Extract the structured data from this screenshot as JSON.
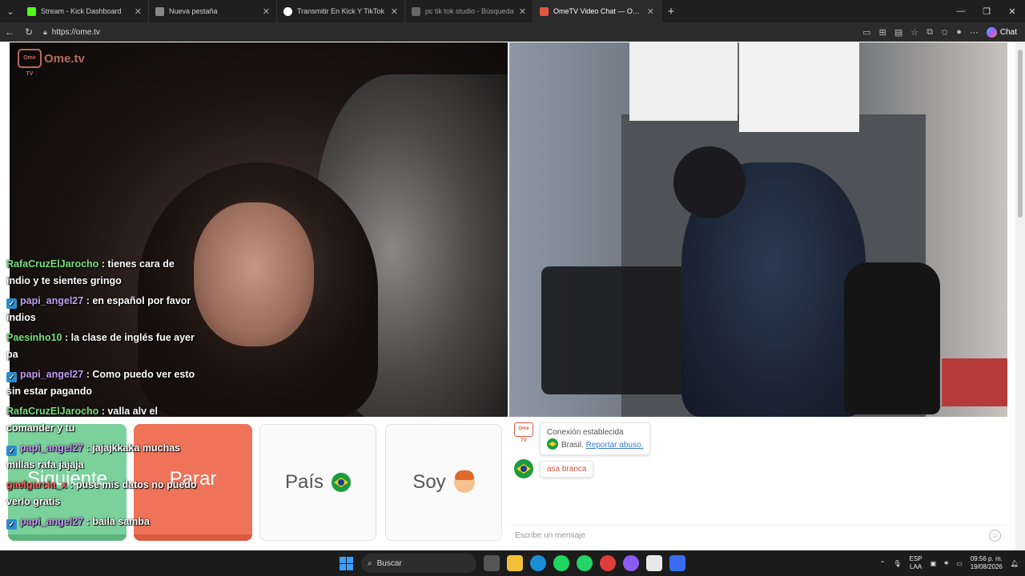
{
  "browser": {
    "tabs": [
      {
        "title": "Stream - Kick Dashboard",
        "color": "#53fc18",
        "active": false
      },
      {
        "title": "Nueva pestaña",
        "color": "#888888",
        "active": false
      },
      {
        "title": "Transmitir En Kick Y TikTok",
        "color": "#ffffff",
        "active": false
      },
      {
        "title": "pc tik tok studio - Búsqueda",
        "color": "#666666",
        "active": false
      },
      {
        "title": "OmeTV Video Chat — Omegl",
        "color": "#e0563f",
        "active": true
      }
    ],
    "url": "https://ome.tv",
    "copilot_label": "Chat"
  },
  "ometv": {
    "logo_text": "Ome.tv",
    "logo_badge": "Ome TV"
  },
  "stream_chat": [
    {
      "user": "RafaCruzElJarocho",
      "user_color": "#7be07b",
      "badge": false,
      "text": ": tienes cara de indio y te sientes gringo"
    },
    {
      "user": "papi_angel27",
      "user_color": "#c39cf2",
      "badge": true,
      "text": ": en español por favor indios"
    },
    {
      "user": "Paesinho10",
      "user_color": "#7be07b",
      "badge": false,
      "text": ": la clase de inglés fue ayer pa"
    },
    {
      "user": "papi_angel27",
      "user_color": "#c39cf2",
      "badge": true,
      "text": ": Como puedo ver esto sin estar pagando"
    },
    {
      "user": "RafaCruzElJarocho",
      "user_color": "#7be07b",
      "badge": false,
      "text": ": valla alv el comander y tu"
    },
    {
      "user": "papi_angel27",
      "user_color": "#c39cf2",
      "badge": true,
      "text": ": jajajkkaka muchas millas rafa jajaja"
    },
    {
      "user": "gaelgarcia_x",
      "user_color": "#ff5a5a",
      "badge": false,
      "text": ": puse mis datos no puedo verlo gratis"
    },
    {
      "user": "papi_angel27",
      "user_color": "#c39cf2",
      "badge": true,
      "text": ": baila samba"
    }
  ],
  "buttons": {
    "next": "Siguiente",
    "stop": "Parar",
    "country": "País",
    "me": "Soy"
  },
  "chat_panel": {
    "system_title": "Conexión establecida",
    "country": "Brasil.",
    "report": "Reportar abuso.",
    "message": "asa branca",
    "input_placeholder": "Escribe un mensaje"
  },
  "taskbar": {
    "search_label": "Buscar",
    "lang_top": "ESP",
    "lang_bottom": "LAA",
    "time": "09:56 p. m.",
    "date": "19/08/2026",
    "app_icons": [
      "file-explorer-icon",
      "edge-icon",
      "spotify-icon",
      "whatsapp-icon",
      "app-red-icon",
      "app-purple-icon",
      "store-icon",
      "app-blue-icon"
    ],
    "app_colors": [
      "#f2c038",
      "#1b8fd6",
      "#1ed760",
      "#25d366",
      "#e03c3c",
      "#8a5cf5",
      "#e8e8e8",
      "#3b6cf0"
    ]
  }
}
